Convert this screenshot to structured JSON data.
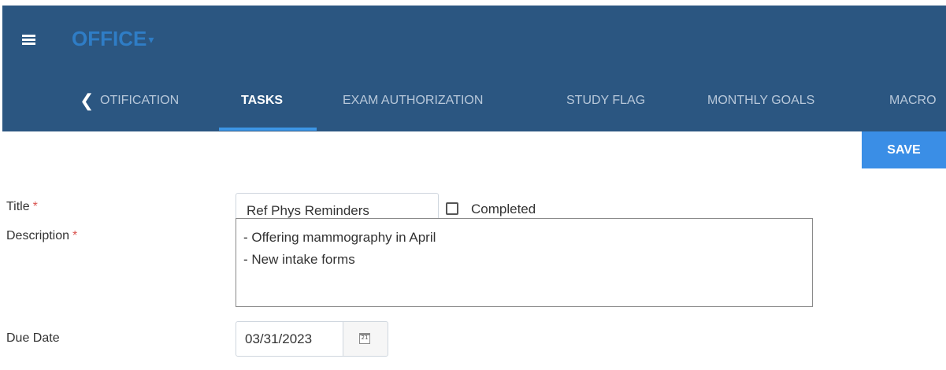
{
  "app": {
    "brand": "OFFICE",
    "brand_caret": "▾",
    "icons": {
      "menu": "hamburger-menu-icon",
      "tabs_back": "chevron-left-icon",
      "calendar": "calendar-icon"
    },
    "colors": {
      "header_bg": "#2b5681",
      "brand": "#2f7dc6",
      "active_tab_indicator": "#3d96e6",
      "save_button": "#3a8ee6",
      "required_marker": "#d9534f"
    }
  },
  "tabs": {
    "back_glyph": "❮",
    "items": [
      {
        "label": "OTIFICATION",
        "active": false
      },
      {
        "label": "TASKS",
        "active": true
      },
      {
        "label": "EXAM AUTHORIZATION",
        "active": false
      },
      {
        "label": "STUDY FLAG",
        "active": false
      },
      {
        "label": "MONTHLY GOALS",
        "active": false
      },
      {
        "label": "MACRO",
        "active": false
      }
    ]
  },
  "toolbar": {
    "save_label": "SAVE"
  },
  "form": {
    "title": {
      "label": "Title",
      "required_marker": "*",
      "value": "Ref Phys Reminders"
    },
    "completed": {
      "label": "Completed",
      "checked": false
    },
    "description": {
      "label": "Description",
      "required_marker": "*",
      "value": "- Offering mammography in April\n- New intake forms"
    },
    "due_date": {
      "label": "Due Date",
      "value": "03/31/2023",
      "calendar_glyph": "21"
    }
  }
}
